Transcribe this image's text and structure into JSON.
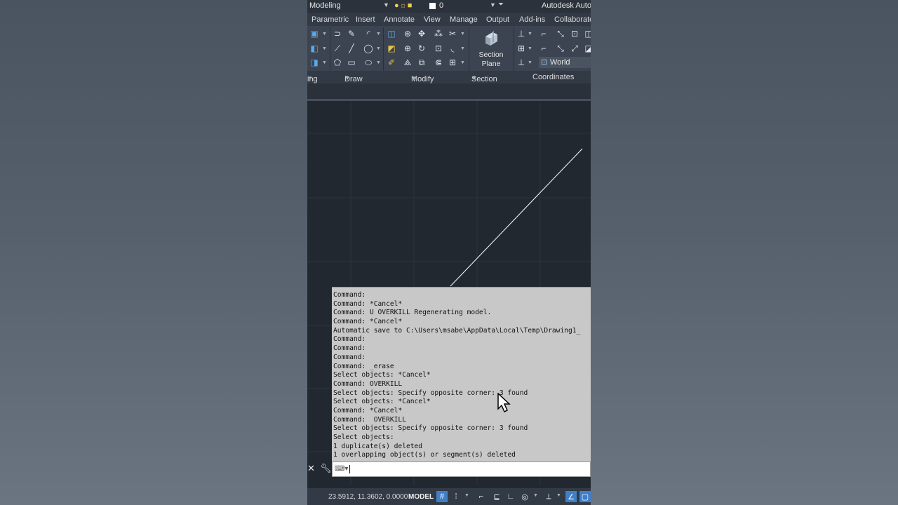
{
  "quick_access": {
    "workspace": "Modeling",
    "layer_name": "0",
    "app_title": "Autodesk AutoC"
  },
  "tabs": [
    "Parametric",
    "Insert",
    "Annotate",
    "View",
    "Manage",
    "Output",
    "Add-ins",
    "Collaborate"
  ],
  "ribbon": {
    "section_plane_line1": "Section",
    "section_plane_line2": "Plane",
    "ucs_value": "World",
    "panels": {
      "modeling_partial": "ing",
      "draw": "Draw",
      "modify": "Modify",
      "section": "Section",
      "coordinates": "Coordinates"
    }
  },
  "command_history": [
    "Command:",
    "Command: *Cancel*",
    "Command: U OVERKILL Regenerating model.",
    "Command: *Cancel*",
    "Automatic save to C:\\Users\\msabe\\AppData\\Local\\Temp\\Drawing1_",
    "Command:",
    "Command:",
    "Command:",
    "Command: _erase",
    "Select objects: *Cancel*",
    "Command: OVERKILL",
    "Select objects: Specify opposite corner: 3 found",
    "Select objects: *Cancel*",
    "Command: *Cancel*",
    "Command:  OVERKILL",
    "Select objects: Specify opposite corner: 3 found",
    "Select objects:",
    "1 duplicate(s) deleted",
    "1 overlapping object(s) or segment(s) deleted"
  ],
  "command_line": {
    "value": ""
  },
  "status_bar": {
    "coordinates": "23.5912, 11.3602, 0.0000",
    "space": "MODEL"
  },
  "colors": {
    "viewport_bg": "#212830",
    "grid_line": "#2c343e",
    "drawn_line": "#ffffff",
    "active_toggle": "#3f7fc8"
  }
}
